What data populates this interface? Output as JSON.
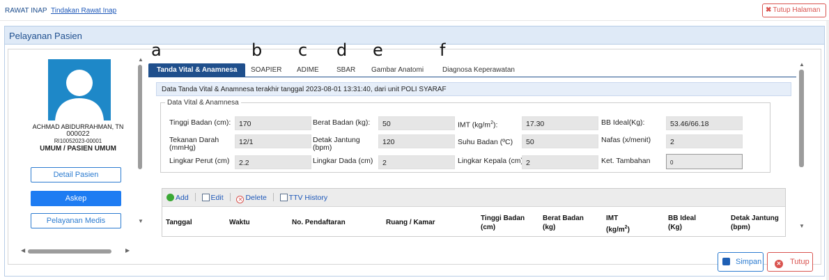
{
  "breadcrumb": {
    "root": "RAWAT INAP",
    "current": "Tindakan Rawat Inap"
  },
  "close_page_label": "Tutup Halaman",
  "panel_title": "Pelayanan Pasien",
  "patient": {
    "name": "ACHMAD ABIDURRAHMAN, TN",
    "id": "000022",
    "registration": "RI10052023-00001",
    "category": "UMUM / PASIEN UMUM"
  },
  "left_buttons": {
    "detail": "Detail Pasien",
    "askep": "Askep",
    "medis": "Pelayanan Medis"
  },
  "annotations": [
    "a",
    "b",
    "c",
    "d",
    "e",
    "f"
  ],
  "tabs": [
    "Tanda Vital & Anamnesa",
    "SOAPIER",
    "ADIME",
    "SBAR",
    "Gambar Anatomi",
    "Diagnosa Keperawatan"
  ],
  "info_text": "Data Tanda Vital & Anamnesa terakhir tanggal 2023-08-01 13:31:40, dari unit POLI SYARAF",
  "vital": {
    "legend": "Data Vital & Anamnesa",
    "tinggi_badan_label": "Tinggi Badan (cm):",
    "tinggi_badan": "170",
    "berat_badan_label": "Berat Badan (kg):",
    "berat_badan": "50",
    "imt_label": "IMT (kg/m",
    "imt_label_sup": "2",
    "imt_label_end": "):",
    "imt": "17.30",
    "bb_ideal_label": "BB Ideal(Kg):",
    "bb_ideal": "53.46/66.18",
    "tekanan_darah_label": "Tekanan Darah",
    "tekanan_darah_unit": "(mmHg)",
    "tekanan_darah": "12/1",
    "detak_jantung_label": "Detak Jantung",
    "detak_jantung_unit": "(bpm)",
    "detak_jantung": "120",
    "suhu_badan_label": "Suhu Badan (ºC)",
    "suhu_badan": "50",
    "nafas_label": "Nafas (x/menit)",
    "nafas": "2",
    "lingkar_perut_label": "Lingkar Perut (cm)",
    "lingkar_perut": "2.2",
    "lingkar_dada_label": "Lingkar Dada (cm)",
    "lingkar_dada": "2",
    "lingkar_kepala_label": "Lingkar Kepala (cm)",
    "lingkar_kepala": "2",
    "ket_tambahan_label": "Ket. Tambahan",
    "ket_tambahan": "0"
  },
  "toolbar": {
    "add": "Add",
    "edit": "Edit",
    "delete": "Delete",
    "history": "TTV History"
  },
  "columns": {
    "tanggal": "Tanggal",
    "waktu": "Waktu",
    "no_pendaftaran": "No. Pendaftaran",
    "ruang": "Ruang / Kamar",
    "tinggi_badan": "Tinggi Badan",
    "tinggi_badan_unit": "(cm)",
    "berat_badan": "Berat Badan",
    "berat_badan_unit": "(kg)",
    "imt": "IMT",
    "imt_unit": "(kg/m",
    "imt_unit_sup": "2",
    "imt_unit_end": ")",
    "bb_ideal": "BB Ideal",
    "bb_ideal_unit": "(Kg)",
    "detak_jantung": "Detak Jantung",
    "detak_jantung_unit": "(bpm)"
  },
  "footer": {
    "save": "Simpan",
    "close": "Tutup"
  },
  "colors": {
    "primary": "#1e7cf2",
    "navy": "#1f4f8c",
    "danger": "#d9534f",
    "avatar": "#1e88c8"
  }
}
